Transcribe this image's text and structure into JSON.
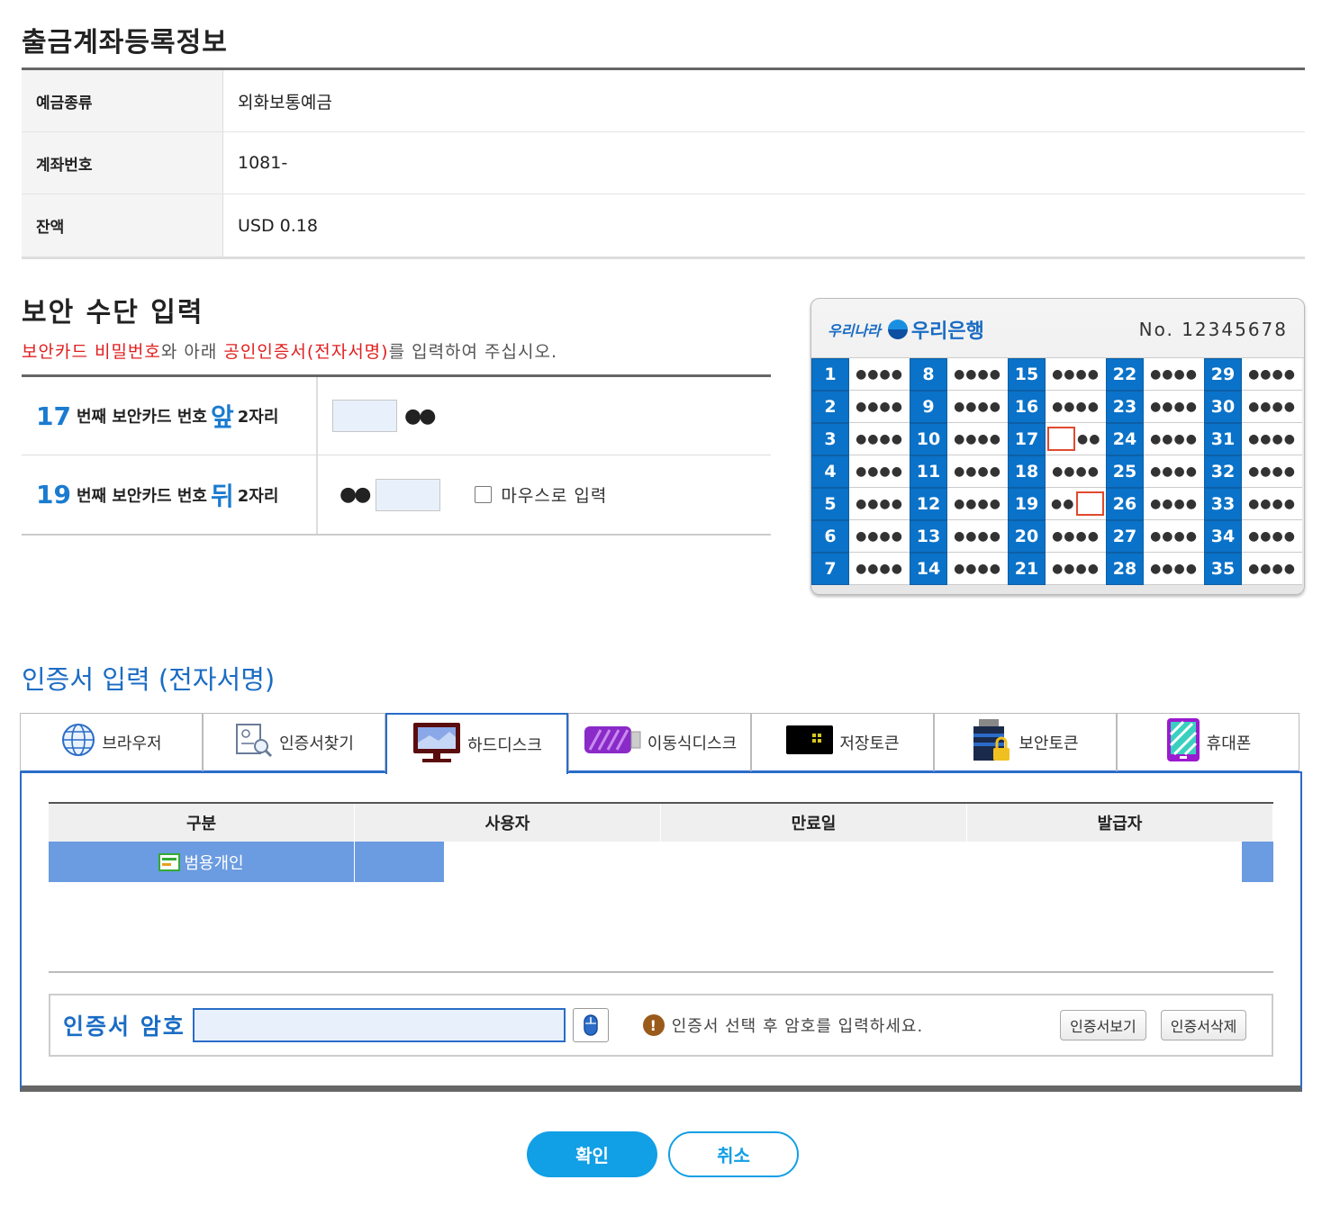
{
  "account": {
    "title": "출금계좌등록정보",
    "rows": [
      {
        "label": "예금종류",
        "value": "외화보통예금"
      },
      {
        "label": "계좌번호",
        "value": "1081-"
      },
      {
        "label": "잔액",
        "value": "USD 0.18"
      }
    ]
  },
  "security": {
    "title": "보안 수단 입력",
    "desc_part1": "보안카드 비밀번호",
    "desc_part2": "와 아래 ",
    "desc_part3": "공인인증서(전자서명)",
    "desc_part4": "를 입력하여 주십시오.",
    "row1": {
      "num": "17",
      "text1": "번째 보안카드 번호 ",
      "pos": "앞",
      "text2": " 2자리",
      "dots": "●●"
    },
    "row2": {
      "num": "19",
      "text1": "번째 보안카드 번호 ",
      "pos": "뒤",
      "text2": " 2자리",
      "dots": "●●",
      "mouse_label": "마우스로 입력"
    }
  },
  "card": {
    "sub_logo": "우리나라",
    "logo": "우리은행",
    "number": "No. 12345678",
    "mask": "●●●●",
    "mask_half": "●●",
    "columns": [
      [
        1,
        2,
        3,
        4,
        5,
        6,
        7
      ],
      [
        8,
        9,
        10,
        11,
        12,
        13,
        14
      ],
      [
        15,
        16,
        17,
        18,
        19,
        20,
        21
      ],
      [
        22,
        23,
        24,
        25,
        26,
        27,
        28
      ],
      [
        29,
        30,
        31,
        32,
        33,
        34,
        35
      ]
    ]
  },
  "cert": {
    "title": "인증서 입력 (전자서명)",
    "tabs": [
      {
        "label": "브라우저",
        "icon": "globe-icon"
      },
      {
        "label": "인증서찾기",
        "icon": "cert-search-icon"
      },
      {
        "label": "하드디스크",
        "icon": "monitor-icon"
      },
      {
        "label": "이동식디스크",
        "icon": "usb-drive-icon"
      },
      {
        "label": "저장토큰",
        "icon": "token-icon"
      },
      {
        "label": "보안토큰",
        "icon": "secure-token-icon"
      },
      {
        "label": "휴대폰",
        "icon": "phone-icon"
      }
    ],
    "headers": [
      "구분",
      "사용자",
      "만료일",
      "발급자"
    ],
    "row_type": "범용개인",
    "password_label": "인증서 암호",
    "hint": "인증서 선택 후 암호를 입력하세요.",
    "view_btn": "인증서보기",
    "delete_btn": "인증서삭제"
  },
  "buttons": {
    "ok": "확인",
    "cancel": "취소"
  },
  "colors": {
    "accent": "#119fe6",
    "card_blue": "#0a72c8",
    "tab_border": "#2a6cc8"
  }
}
